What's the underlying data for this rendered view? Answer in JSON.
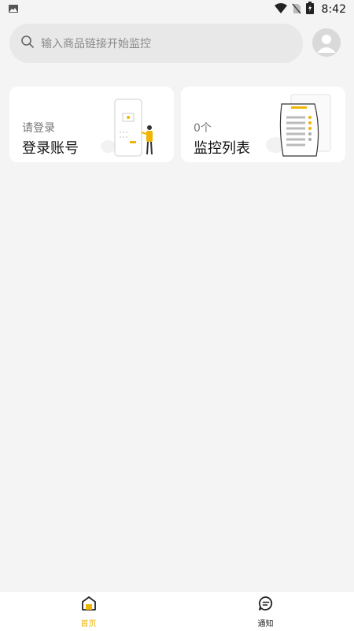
{
  "status_bar": {
    "time": "8:42",
    "icons": [
      "image-icon",
      "wifi-icon",
      "no-sim-icon",
      "battery-charging-icon"
    ]
  },
  "search": {
    "placeholder": "输入商品链接开始监控",
    "icon": "search-icon"
  },
  "profile": {
    "icon": "avatar-icon"
  },
  "cards": {
    "login": {
      "subtitle": "请登录",
      "title": "登录账号"
    },
    "monitor": {
      "subtitle": "0个",
      "title": "监控列表"
    }
  },
  "tabs": [
    {
      "label": "首页",
      "icon": "home-icon",
      "active": true
    },
    {
      "label": "通知",
      "icon": "chat-icon",
      "active": false
    }
  ],
  "colors": {
    "accent": "#f0b500",
    "background": "#f4f4f4",
    "card": "#ffffff"
  }
}
